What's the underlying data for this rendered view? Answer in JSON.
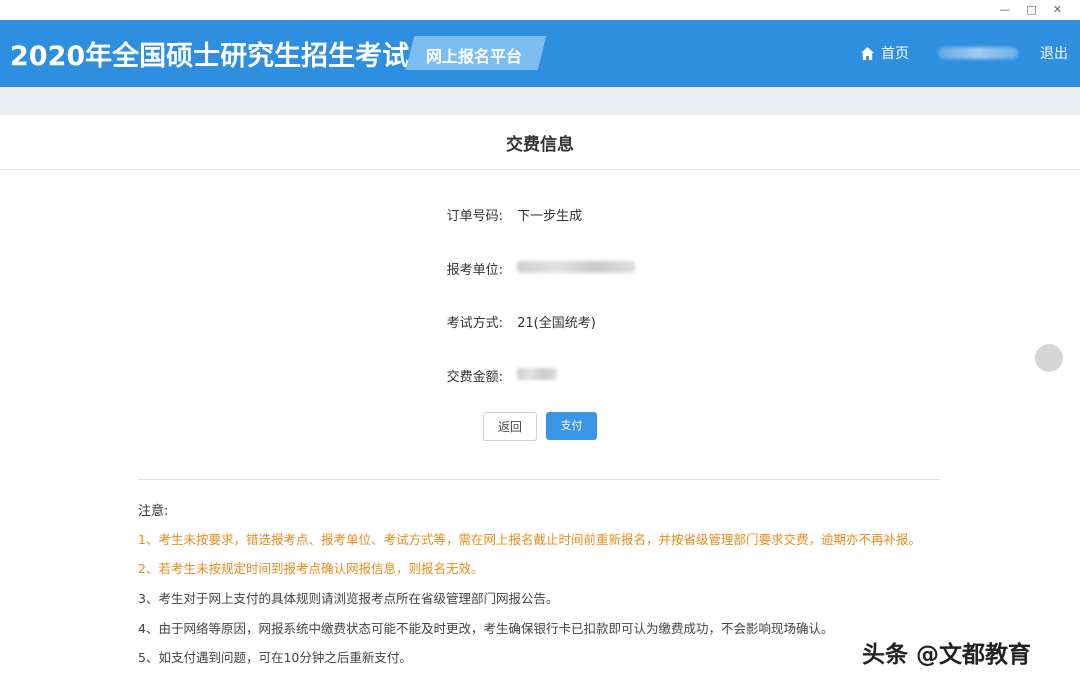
{
  "window": {
    "controls": [
      "—",
      "□",
      "✕"
    ]
  },
  "header": {
    "site_title": "2020年全国硕士研究生招生考试",
    "platform": "网上报名平台",
    "home_label": "首页",
    "logout_label": "退出",
    "home_icon": "home-icon",
    "accent_color": "#2e8ee0"
  },
  "payment": {
    "title": "交费信息",
    "fields": [
      {
        "label": "订单号码:",
        "value": "下一步生成"
      },
      {
        "label": "报考单位:",
        "value": ""
      },
      {
        "label": "考试方式:",
        "value": "21(全国统考)"
      },
      {
        "label": "交费金额:",
        "value": ""
      }
    ],
    "back_label": "返回",
    "pay_label": "支付"
  },
  "notes": {
    "title": "注意:",
    "items": [
      "1、考生未按要求，错选报考点、报考单位、考试方式等，需在网上报名截止时间前重新报名，并按省级管理部门要求交费，逾期亦不再补报。",
      "2、若考生未按规定时间到报考点确认网报信息，则报名无效。",
      "3、考生对于网上支付的具体规则请浏览报考点所在省级管理部门网报公告。",
      "4、由于网络等原因，网报系统中缴费状态可能不能及时更改，考生确保银行卡已扣款即可认为缴费成功，不会影响现场确认。",
      "5、如支付遇到问题，可在10分钟之后重新支付。"
    ],
    "warn_color": "#ec8a1c"
  },
  "watermark": "头条 @文都教育"
}
